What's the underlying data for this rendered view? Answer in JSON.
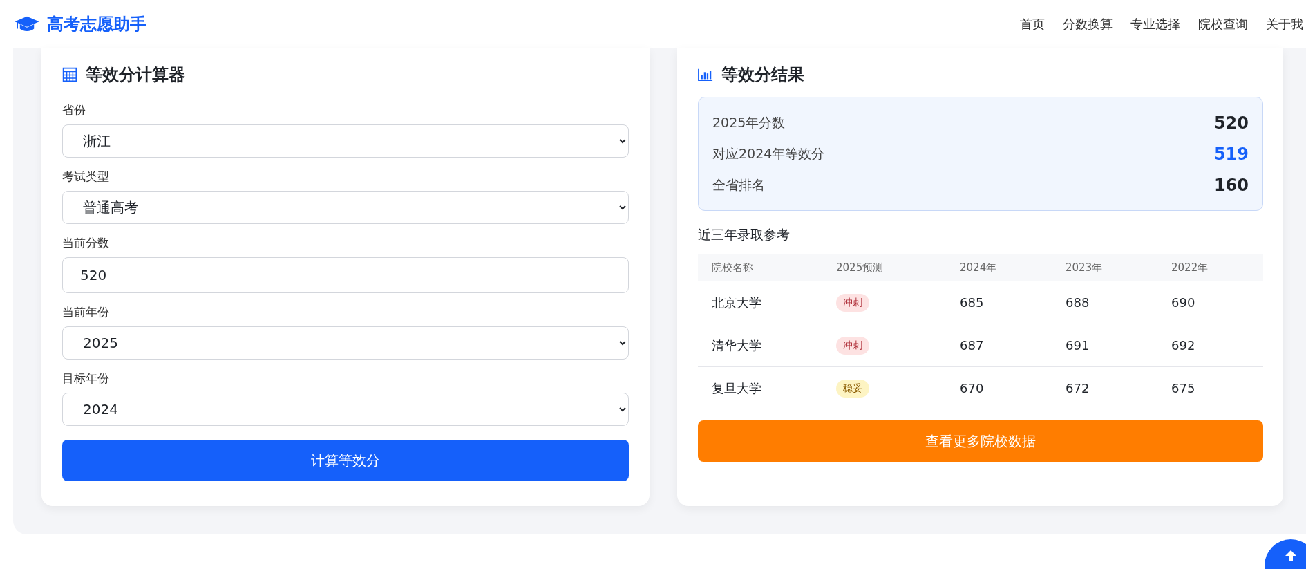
{
  "header": {
    "logo": "高考志愿助手",
    "nav": [
      "首页",
      "分数换算",
      "专业选择",
      "院校查询",
      "关于我"
    ]
  },
  "calculator": {
    "title": "等效分计算器",
    "fields": [
      {
        "kind": "select",
        "label": "省份",
        "value": "浙江"
      },
      {
        "kind": "select",
        "label": "考试类型",
        "value": "普通高考"
      },
      {
        "kind": "input",
        "label": "当前分数",
        "value": "520"
      },
      {
        "kind": "select",
        "label": "当前年份",
        "value": "2025"
      },
      {
        "kind": "select",
        "label": "目标年份",
        "value": "2024"
      }
    ],
    "button": "计算等效分"
  },
  "result": {
    "title": "等效分结果",
    "summary": [
      {
        "label": "2025年分数",
        "value": "520",
        "highlight": false
      },
      {
        "label": "对应2024年等效分",
        "value": "519",
        "highlight": true
      },
      {
        "label": "全省排名",
        "value": "160",
        "highlight": false
      }
    ],
    "subtitle": "近三年录取参考",
    "table": {
      "columns": [
        "院校名称",
        "2025预测",
        "2024年",
        "2023年",
        "2022年"
      ],
      "rows": [
        {
          "name": "北京大学",
          "tag": "冲刺",
          "kind": "reach",
          "scores": [
            "685",
            "688",
            "690"
          ]
        },
        {
          "name": "清华大学",
          "tag": "冲刺",
          "kind": "reach",
          "scores": [
            "687",
            "691",
            "692"
          ]
        },
        {
          "name": "复旦大学",
          "tag": "稳妥",
          "kind": "safe",
          "scores": [
            "670",
            "672",
            "675"
          ]
        }
      ]
    },
    "button": "查看更多院校数据"
  }
}
